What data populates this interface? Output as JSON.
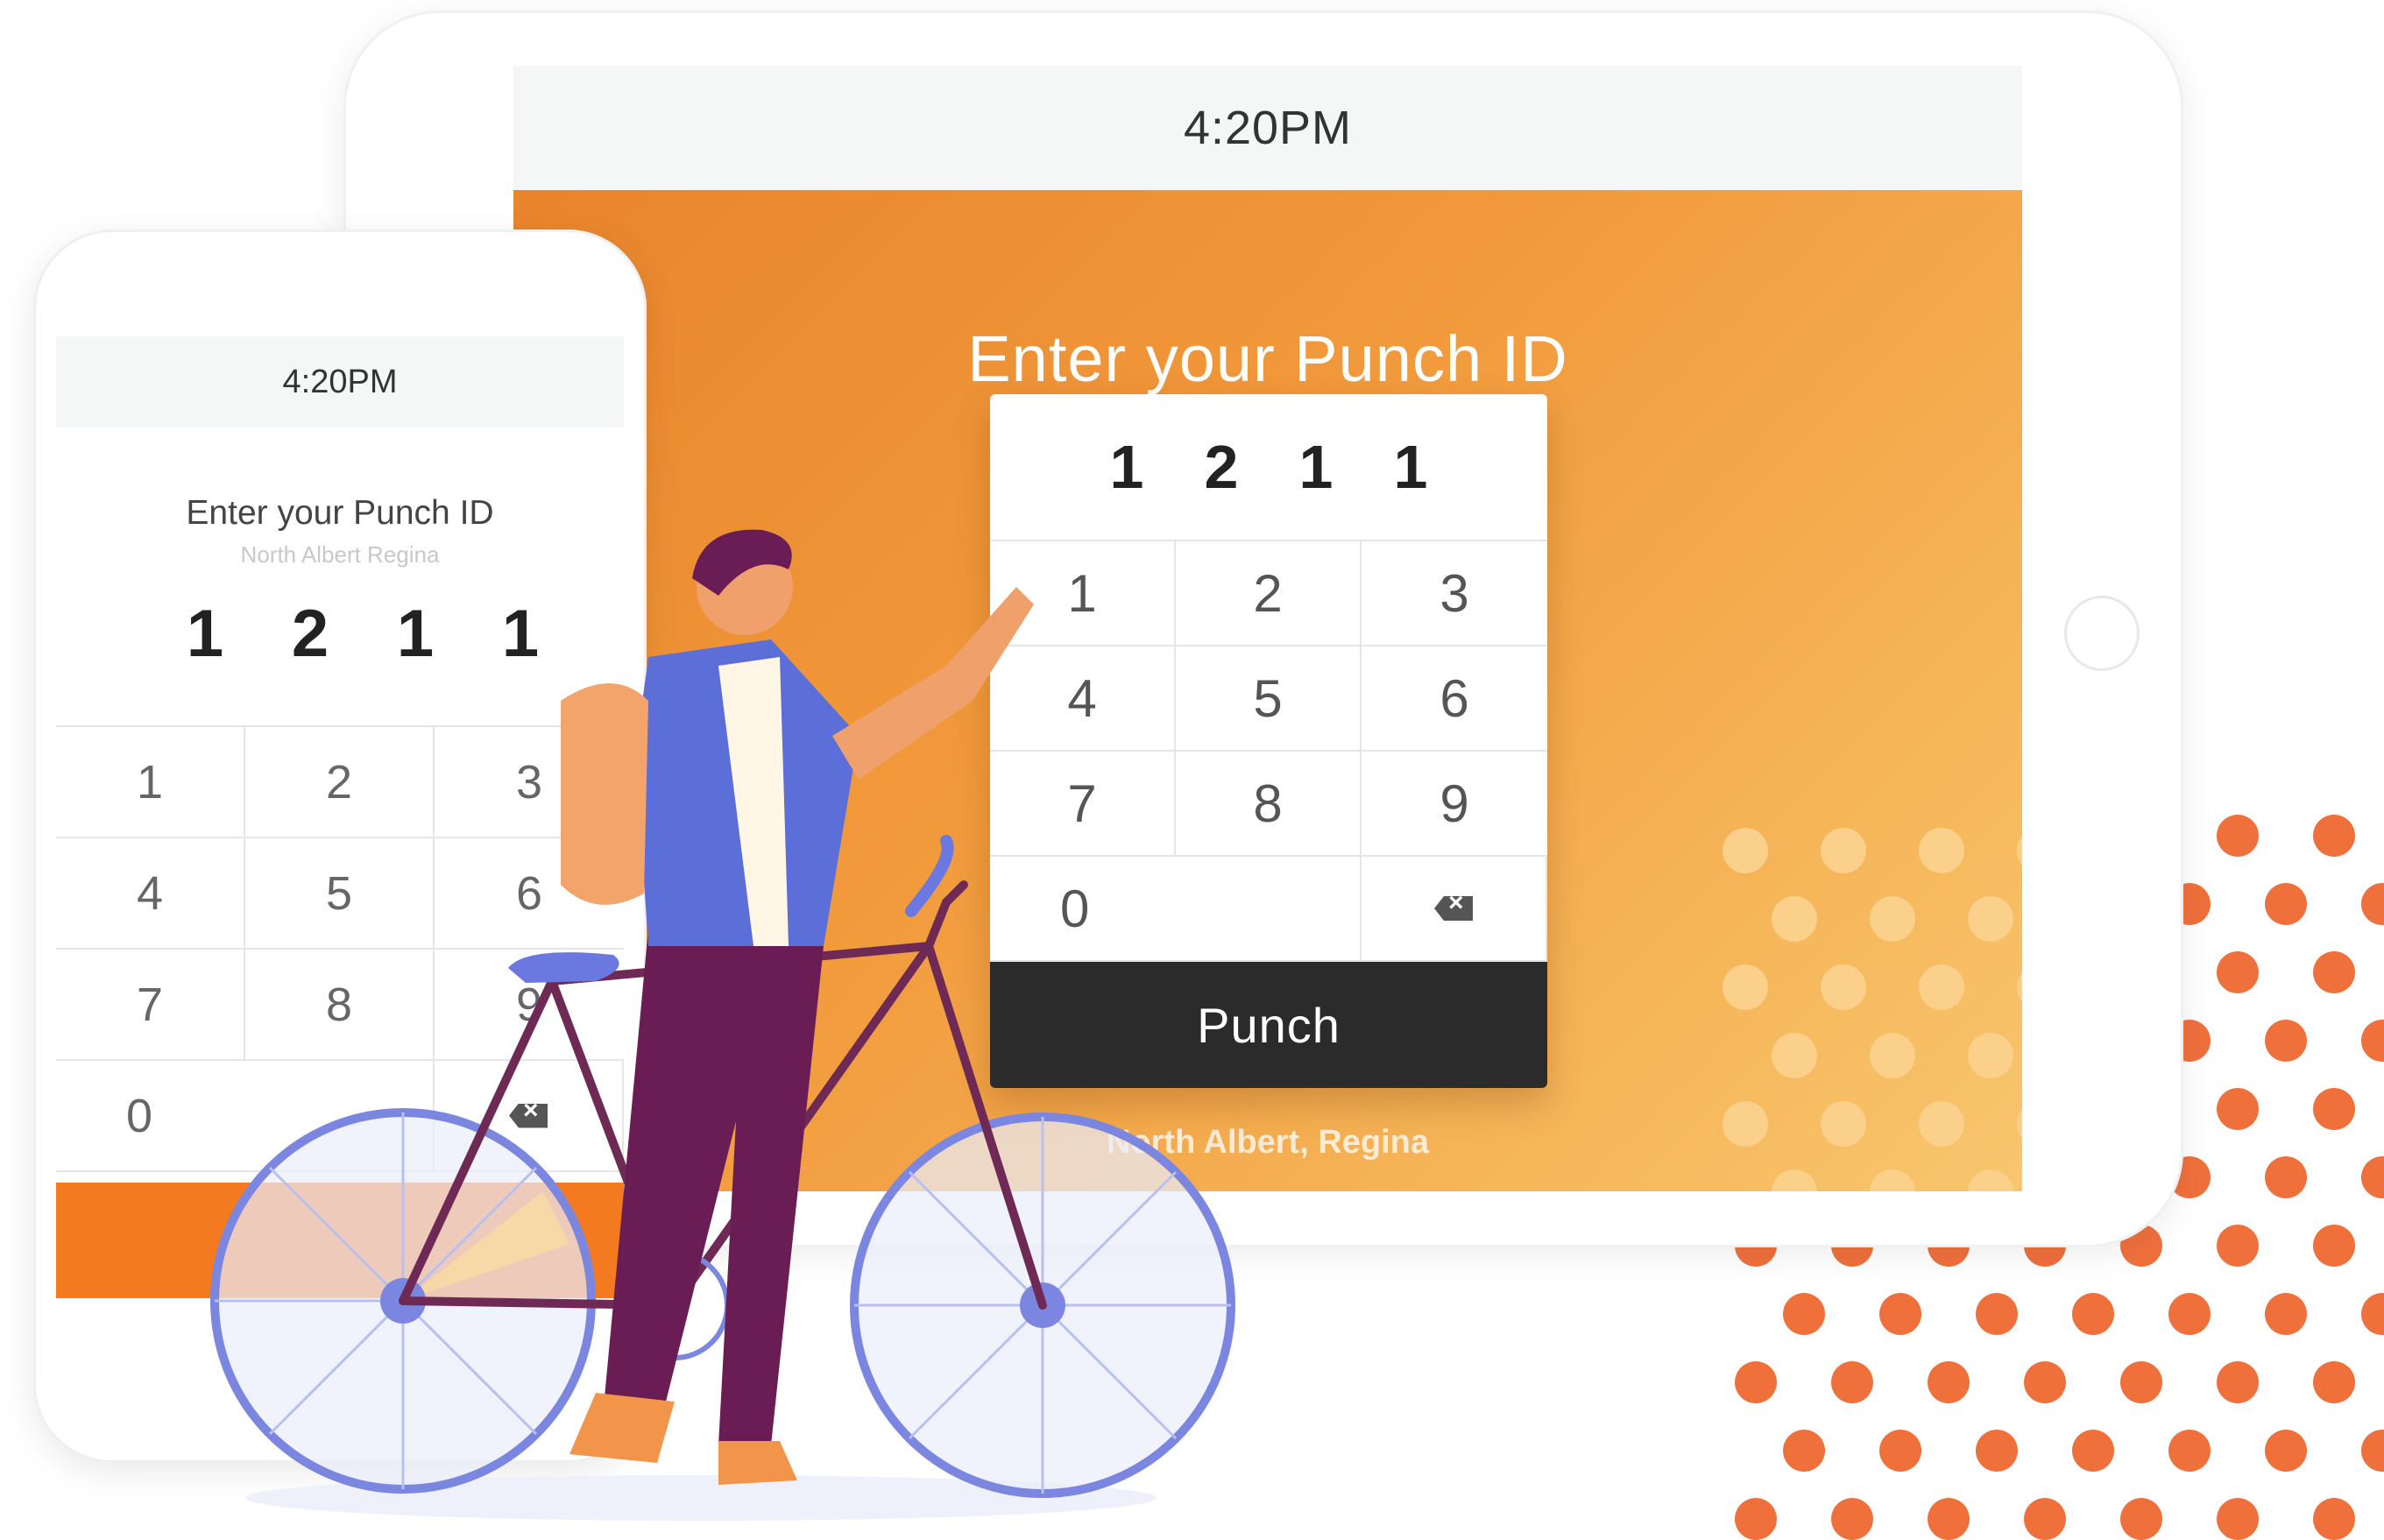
{
  "colors": {
    "accent_orange": "#f19a3c",
    "punch_button": "#2b2b2b",
    "phone_orange_bar": "#f47a1f",
    "dot_dark": "#f0703c",
    "dot_light": "#fbd08a"
  },
  "tablet": {
    "clock": "4:20PM",
    "title": "Enter your Punch ID",
    "pin": [
      "1",
      "2",
      "1",
      "1"
    ],
    "keys": [
      "1",
      "2",
      "3",
      "4",
      "5",
      "6",
      "7",
      "8",
      "9",
      "0"
    ],
    "punch_label": "Punch",
    "location": "North Albert, Regina",
    "backspace_icon": "backspace-icon"
  },
  "phone": {
    "clock": "4:20PM",
    "title": "Enter your Punch ID",
    "subtitle": "North Albert Regina",
    "pin": [
      "1",
      "2",
      "1",
      "1"
    ],
    "keys": [
      "1",
      "2",
      "3",
      "4",
      "5",
      "6",
      "7",
      "8",
      "9",
      "0"
    ],
    "backspace_icon": "backspace-icon"
  },
  "illustration": {
    "subject": "person-with-bicycle-illustration"
  }
}
